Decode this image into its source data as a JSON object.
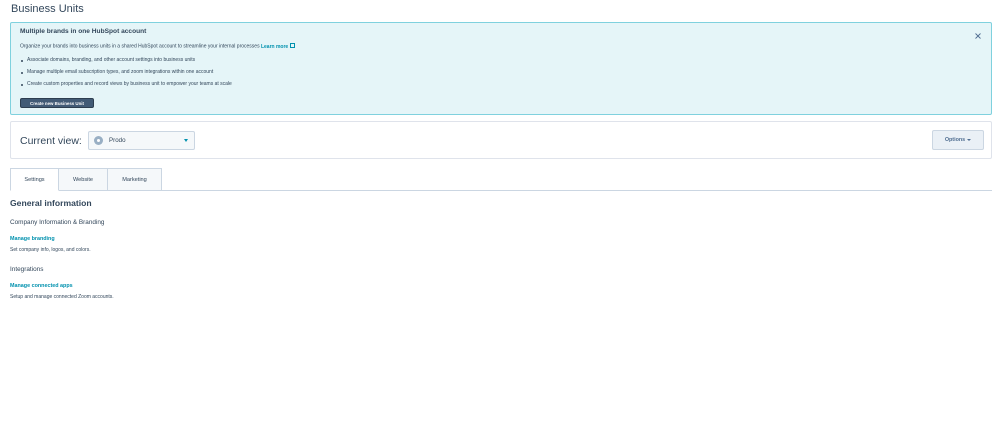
{
  "page": {
    "title": "Business Units"
  },
  "banner": {
    "heading": "Multiple brands in one HubSpot account",
    "body": "Organize your brands into business units in a shared HubSpot account to streamline your internal processes",
    "learn_more": "Learn more",
    "bullets": [
      "Associate domains, branding, and other account settings into business units",
      "Manage multiple email subscription types, and zoom integrations within one account",
      "Create custom properties and record views by business unit to empower your teams at scale"
    ],
    "create_button": "Create new Business Unit",
    "close_icon": "close-icon"
  },
  "view": {
    "label": "Current view:",
    "selected": "Prodo",
    "options_button": "Options"
  },
  "tabs": [
    {
      "label": "Settings",
      "active": true
    },
    {
      "label": "Website",
      "active": false
    },
    {
      "label": "Marketing",
      "active": false
    }
  ],
  "general": {
    "title": "General information",
    "company": {
      "title": "Company Information & Branding",
      "link": "Manage branding",
      "desc": "Set company info, logos, and colors."
    },
    "integrations": {
      "title": "Integrations",
      "link": "Manage connected apps",
      "desc": "Setup and manage connected Zoom accounts."
    }
  },
  "colors": {
    "banner_bg": "#e5f5f8",
    "banner_border": "#7fd1de",
    "link": "#0091ae",
    "text": "#33475b",
    "button_dark": "#425b76"
  }
}
